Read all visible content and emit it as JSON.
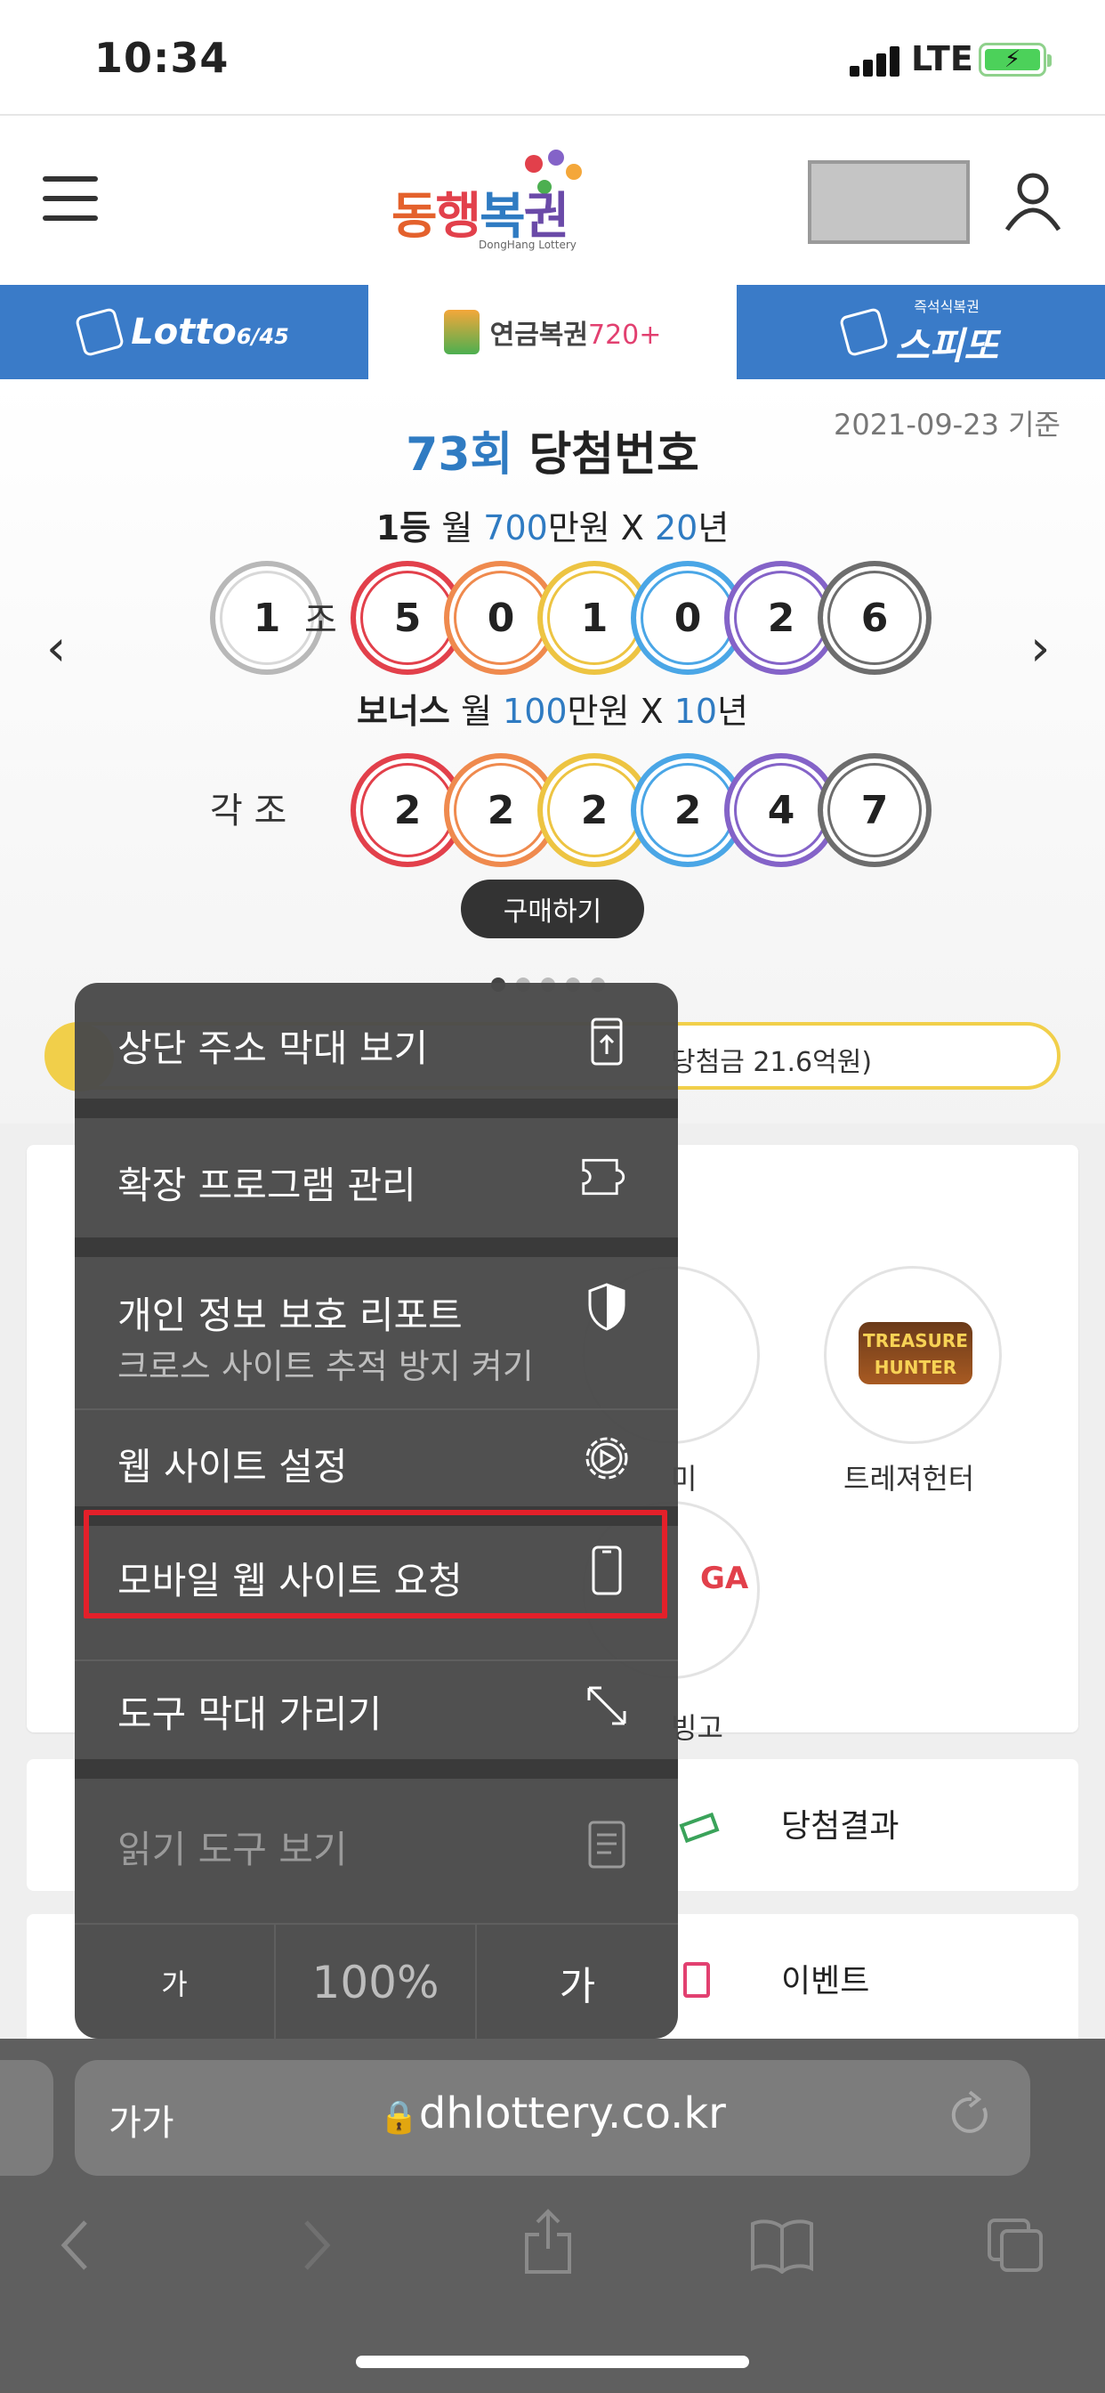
{
  "status": {
    "time": "10:34",
    "network": "LTE"
  },
  "header": {
    "logo_text": "동행복권",
    "logo_sub": "DongHang Lottery"
  },
  "tabs": [
    {
      "label": "Lotto",
      "suffix": "6/45"
    },
    {
      "label": "연금복권",
      "suffix": "720+"
    },
    {
      "label": "스피또",
      "sub": "즉석식복권"
    }
  ],
  "result": {
    "date": "2021-09-23 기준",
    "round": "73회",
    "title": "당첨번호",
    "first_prize": {
      "rank": "1등",
      "monthly": "월",
      "amount": "700",
      "unit": "만원 X",
      "years": "20",
      "years_unit": "년"
    },
    "first_group": "1",
    "first_group_label": "조",
    "first_numbers": [
      "5",
      "0",
      "1",
      "0",
      "2",
      "6"
    ],
    "bonus_prize": {
      "rank": "보너스",
      "monthly": "월",
      "amount": "100",
      "unit": "만원 X",
      "years": "10",
      "years_unit": "년"
    },
    "bonus_group_label": "각 조",
    "bonus_numbers": [
      "2",
      "2",
      "2",
      "2",
      "4",
      "7"
    ],
    "buy_label": "구매하기",
    "notice_text": "당첨금 21.6억원)"
  },
  "games": [
    {
      "label": "미"
    },
    {
      "label": "트레져헌터",
      "logo": "TREASURE HUNTER"
    },
    {
      "label": "빙고",
      "logo": "GA"
    }
  ],
  "links": [
    {
      "label": "당첨결과"
    },
    {
      "label": "이벤트"
    }
  ],
  "menu": {
    "items": [
      {
        "label": "상단 주소 막대 보기",
        "icon": "top-address-bar-icon"
      },
      {
        "label": "확장 프로그램 관리",
        "icon": "puzzle-icon"
      },
      {
        "label": "개인 정보 보호 리포트",
        "sublabel": "크로스 사이트 추적 방지 켜기",
        "icon": "shield-icon"
      },
      {
        "label": "웹 사이트 설정",
        "icon": "gear-icon"
      },
      {
        "label": "모바일 웹 사이트 요청",
        "icon": "phone-icon"
      },
      {
        "label": "도구 막대 가리기",
        "icon": "expand-icon"
      },
      {
        "label": "읽기 도구 보기",
        "icon": "reader-icon"
      }
    ],
    "zoom": {
      "smaller": "가",
      "value": "100%",
      "larger": "가"
    }
  },
  "browser": {
    "aa": "가가",
    "url": "dhlottery.co.kr"
  }
}
